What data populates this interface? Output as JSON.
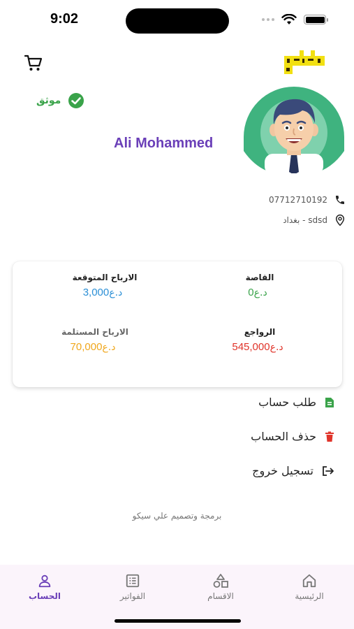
{
  "status_bar": {
    "time": "9:02"
  },
  "header": {
    "logo_text": "ميجاتي"
  },
  "profile": {
    "name": "Ali Mohammed",
    "verified_label": "موثق",
    "phone": "07712710192",
    "address": "بغداد - sdsd"
  },
  "stats": {
    "balance": {
      "label": "القاصة",
      "value": "0",
      "currency": "د.ع",
      "color": "#3aa34a"
    },
    "expected_profits": {
      "label": "الارباح المتوقعة",
      "value": "3,000",
      "currency": "د.ع",
      "color": "#2b8fd6"
    },
    "returns": {
      "label": "الرواجع",
      "value": "545,000",
      "currency": "د.ع",
      "color": "#e0342a"
    },
    "received_profits": {
      "label": "الارباح المستلمة",
      "value": "70,000",
      "currency": "د.ع",
      "color": "#f0a71c"
    }
  },
  "menu": {
    "request_account": "طلب حساب",
    "delete_account": "حذف الحساب",
    "logout": "تسجيل خروج"
  },
  "credit": "برمجة وتصميم علي سيكو",
  "bottom_nav": {
    "account": "الحساب",
    "invoices": "الفواتير",
    "categories": "الاقسام",
    "home": "الرئيسية",
    "active": "account"
  },
  "colors": {
    "accent": "#6a3fb8",
    "verified": "#3aa34a",
    "logo_yellow": "#f2e012",
    "nav_background": "#fbf4fb"
  },
  "icons": [
    "cart-icon",
    "check-circle-icon",
    "phone-icon",
    "location-pin-icon",
    "document-icon",
    "trash-icon",
    "logout-icon",
    "person-icon",
    "invoice-icon",
    "shapes-icon",
    "home-icon"
  ]
}
